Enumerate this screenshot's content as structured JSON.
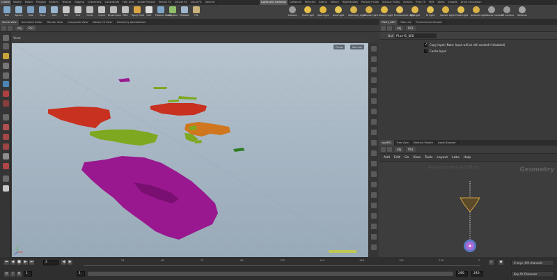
{
  "shelf": {
    "tabs_left": [
      "Create",
      "Modify",
      "Model",
      "Polygon",
      "Deform",
      "Texture",
      "Rigging",
      "Characters",
      "Constraints",
      "Hair Utils",
      "Guide Process",
      "Terrain FX",
      "Simple FX",
      "Cloud FX",
      "Volume"
    ],
    "tabs_right": [
      "Lights and Cameras",
      "Collisions",
      "Particles",
      "Grains",
      "Vellum",
      "Rigid Bodies",
      "Particle Fluids",
      "Viscous Fluids",
      "Oceans",
      "Pyro FX",
      "FEM",
      "Wires",
      "Crowds",
      "Drive Simulation"
    ],
    "tools_left": [
      {
        "label": "Box",
        "color": "#7fa6c9"
      },
      {
        "label": "Sphere",
        "color": "#8fb1d0"
      },
      {
        "label": "Tube",
        "color": "#7b9fc2"
      },
      {
        "label": "Torus",
        "color": "#86a9cb"
      },
      {
        "label": "Grid",
        "color": "#9ab5cf"
      },
      {
        "label": "Null",
        "color": "#c8c8c8"
      },
      {
        "label": "Line",
        "color": "#c9c9c9"
      },
      {
        "label": "Circle",
        "color": "#bdbdbd"
      },
      {
        "label": "Curve",
        "color": "#c4c4c4"
      },
      {
        "label": "Draw Curve",
        "color": "#b9b9b9"
      },
      {
        "label": "Path",
        "color": "#c0c0c0"
      },
      {
        "label": "Spray Paint",
        "color": "#d9a441"
      },
      {
        "label": "Font",
        "color": "#dddddd"
      },
      {
        "label": "Platonic Solids",
        "color": "#7fa6c9"
      },
      {
        "label": "L-System",
        "color": "#8fbf6a"
      },
      {
        "label": "Metaball",
        "color": "#9fb6cc"
      },
      {
        "label": "File",
        "color": "#c9b27a"
      }
    ],
    "tools_right": [
      {
        "label": "Camera",
        "color": "#9c9c9c"
      },
      {
        "label": "Point Light",
        "color": "#e6c04a"
      },
      {
        "label": "Spot Light",
        "color": "#e3b93f"
      },
      {
        "label": "Area Light",
        "color": "#e7c756"
      },
      {
        "label": "Geometry Light",
        "color": "#d9b54b"
      },
      {
        "label": "Volume Light",
        "color": "#dcb246"
      },
      {
        "label": "Distant Light",
        "color": "#e2bb49"
      },
      {
        "label": "Environment Light",
        "color": "#e6c25a"
      },
      {
        "label": "Sky Light",
        "color": "#e0b84a"
      },
      {
        "label": "GI Light",
        "color": "#e5c152"
      },
      {
        "label": "Caustic Light",
        "color": "#ddb444"
      },
      {
        "label": "Portal Light",
        "color": "#e3bf50"
      },
      {
        "label": "Ambient Light",
        "color": "#d8b044"
      },
      {
        "label": "Stereo Camera",
        "color": "#a0a0a0"
      },
      {
        "label": "VR Camera",
        "color": "#9a9a9a"
      },
      {
        "label": "Switcher",
        "color": "#a5a5a5"
      }
    ]
  },
  "left_panes": {
    "tabs": [
      "Scene View",
      "Animation Editor",
      "Render View",
      "Composite View",
      "Motion FX View",
      "Geometry Spreadsheet"
    ],
    "path": "obj",
    "path_node": "PS1",
    "view_title": "View",
    "persp_label": "Persp",
    "cam_label": "No cam"
  },
  "right_top": {
    "tabs": [
      "Platf1_GEO",
      "Take List",
      "Performance Monitor"
    ],
    "path": "obj",
    "path_node": "PS1",
    "node_type": "Null",
    "node_name": "Platf1_GEO",
    "param1_label": "Copy Input (Note: Input will be still cooked if disabled)",
    "param1_checked": true,
    "param2_label": "Cache Input",
    "param2_checked": false
  },
  "right_bottom": {
    "tabs": [
      "/obj/PS1",
      "Tree View",
      "Material Palette",
      "Asset Browser"
    ],
    "path": "obj",
    "path_node": "PS1",
    "menu": [
      "Add",
      "Edit",
      "Go",
      "View",
      "Tools",
      "Layout",
      "Labs",
      "Help"
    ],
    "watermark": "Non-Commercial Edition",
    "context_label": "Geometry"
  },
  "timeline": {
    "current_frame": "2",
    "start_frame": "1",
    "start_frame2": "1",
    "end_frame": "240",
    "end_frame2": "240",
    "ticks": [
      "24",
      "48",
      "72",
      "96",
      "120",
      "144",
      "168",
      "192",
      "216",
      "2"
    ],
    "keys_label": "0 keys, 0/0 channels",
    "key_all_label": "Key All Channels"
  },
  "colors": {
    "accent_red": "#c8301f",
    "accent_green": "#7ea81f",
    "accent_orange": "#d0761e",
    "accent_purple": "#99188f",
    "node_purple": "#b06ad6"
  }
}
